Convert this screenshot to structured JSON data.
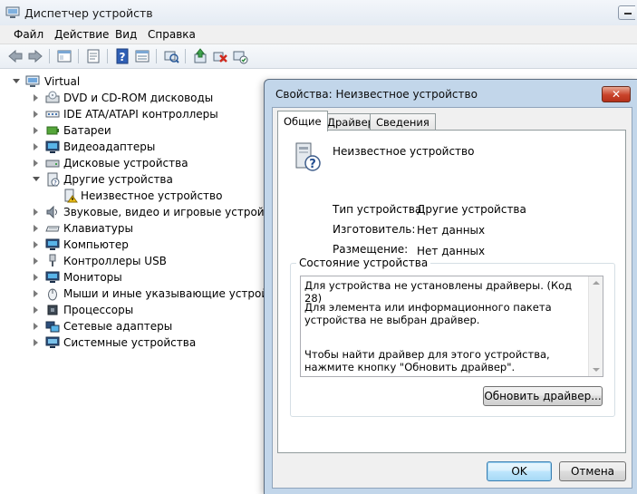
{
  "window": {
    "title": "Диспетчер устройств"
  },
  "menu": [
    "Файл",
    "Действие",
    "Вид",
    "Справка"
  ],
  "tree": {
    "root": "Virtual",
    "items": [
      "DVD и CD-ROM дисководы",
      "IDE ATA/ATAPI контроллеры",
      "Батареи",
      "Видеоадаптеры",
      "Дисковые устройства",
      "Другие устройства",
      "Неизвестное устройство",
      "Звуковые, видео и игровые устройства",
      "Клавиатуры",
      "Компьютер",
      "Контроллеры USB",
      "Мониторы",
      "Мыши и иные указывающие устройства",
      "Процессоры",
      "Сетевые адаптеры",
      "Системные устройства"
    ]
  },
  "dialog": {
    "title": "Свойства: Неизвестное устройство",
    "close_label": "✕",
    "tabs": [
      "Общие",
      "Драйвер",
      "Сведения"
    ],
    "device_name": "Неизвестное устройство",
    "properties": [
      {
        "label": "Тип устройства:",
        "value": "Другие устройства"
      },
      {
        "label": "Изготовитель:",
        "value": "Нет данных"
      },
      {
        "label": "Размещение:",
        "value": "Нет данных"
      }
    ],
    "status_group_label": "Состояние устройства",
    "status_lines": [
      "Для устройства не установлены драйверы. (Код 28)",
      "Для элемента или информационного пакета устройства не выбран драйвер.",
      "Чтобы найти драйвер для этого устройства, нажмите кнопку \"Обновить драйвер\"."
    ],
    "update_driver_button": "Обновить драйвер...",
    "ok_button": "OK",
    "cancel_button": "Отмена"
  }
}
